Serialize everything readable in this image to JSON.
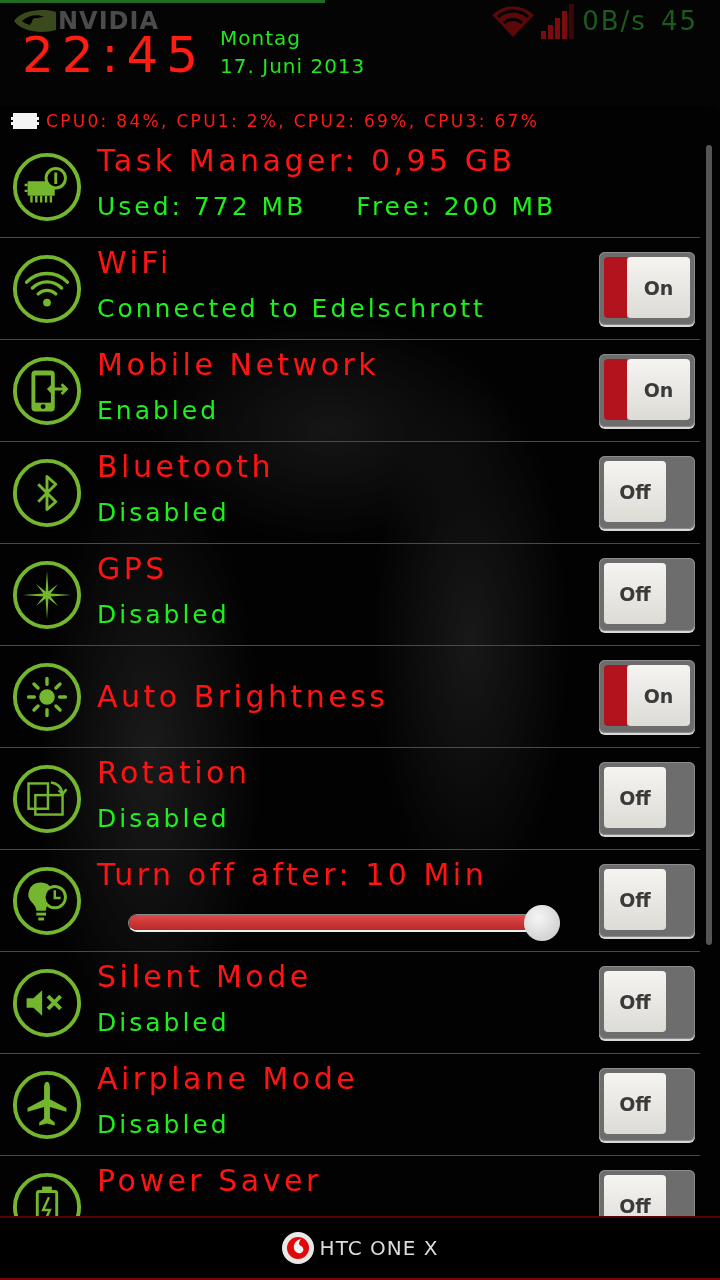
{
  "status_bar": {
    "brand": "NVIDIA",
    "speed": "0B/s",
    "battery": "45"
  },
  "clock": {
    "time": "22:45",
    "weekday": "Montag",
    "date": "17. Juni 2013"
  },
  "cpu_usage": "CPU0: 84%, CPU1: 2%, CPU2: 69%, CPU3: 67%",
  "items": [
    {
      "kind": "memory",
      "title": "Task Manager: 0,95 GB",
      "used": "Used: 772 MB",
      "free": "Free: 200 MB"
    },
    {
      "kind": "toggle",
      "title": "WiFi",
      "status": "Connected to Edelschrott",
      "switch": {
        "label": "On",
        "on": true
      }
    },
    {
      "kind": "toggle",
      "title": "Mobile Network",
      "status": "Enabled",
      "switch": {
        "label": "On",
        "on": true
      }
    },
    {
      "kind": "toggle",
      "title": "Bluetooth",
      "status": "Disabled",
      "switch": {
        "label": "Off",
        "on": false
      }
    },
    {
      "kind": "toggle",
      "title": "GPS",
      "status": "Disabled",
      "switch": {
        "label": "Off",
        "on": false
      }
    },
    {
      "kind": "single",
      "title": "Auto Brightness",
      "switch": {
        "label": "On",
        "on": true
      }
    },
    {
      "kind": "toggle",
      "title": "Rotation",
      "status": "Disabled",
      "switch": {
        "label": "Off",
        "on": false
      }
    },
    {
      "kind": "slider",
      "title": "Turn off after: 10 Min",
      "level": 1,
      "switch": {
        "label": "Off",
        "on": false
      }
    },
    {
      "kind": "toggle",
      "title": "Silent Mode",
      "status": "Disabled",
      "switch": {
        "label": "Off",
        "on": false
      }
    },
    {
      "kind": "toggle",
      "title": "Airplane Mode",
      "status": "Disabled",
      "switch": {
        "label": "Off",
        "on": false
      }
    },
    {
      "kind": "toggle",
      "title": "Power Saver",
      "switch": {
        "label": "Off",
        "on": false
      }
    }
  ],
  "footer": {
    "device": "HTC ONE X"
  }
}
